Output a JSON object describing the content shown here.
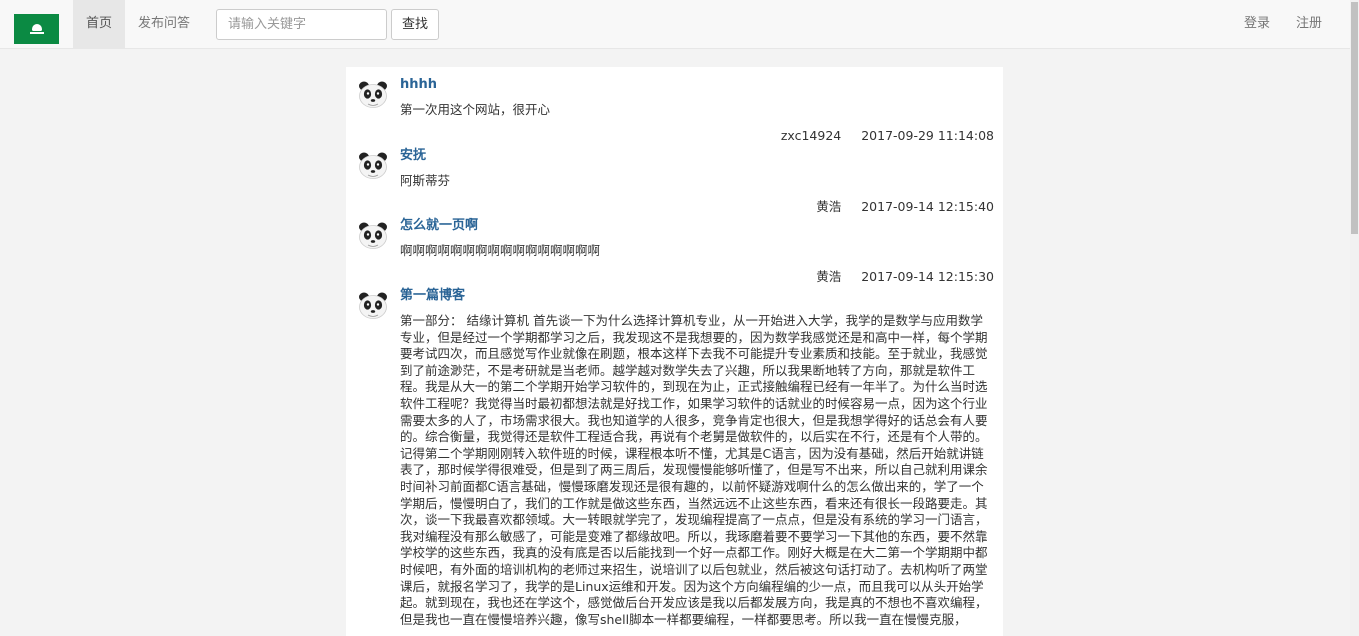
{
  "navbar": {
    "brand_icon": "macau-flag-icon",
    "brand_color": "#0b8a43",
    "home_label": "首页",
    "ask_label": "发布问答",
    "search_placeholder": "请输入关键字",
    "search_button_label": "查找",
    "login_label": "登录",
    "register_label": "注册"
  },
  "posts": [
    {
      "title": "hhhh",
      "body": "第一次用这个网站，很开心",
      "author": "zxc14924",
      "time": "2017-09-29 11:14:08"
    },
    {
      "title": "安抚",
      "body": "阿斯蒂芬",
      "author": "黄浩",
      "time": "2017-09-14 12:15:40"
    },
    {
      "title": "怎么就一页啊",
      "body": "啊啊啊啊啊啊啊啊啊啊啊啊啊啊啊啊",
      "author": "黄浩",
      "time": "2017-09-14 12:15:30"
    },
    {
      "title": "第一篇博客",
      "body": "第一部分： 结缘计算机 首先谈一下为什么选择计算机专业，从一开始进入大学，我学的是数学与应用数学专业，但是经过一个学期都学习之后，我发现这不是我想要的，因为数学我感觉还是和高中一样，每个学期要考试四次，而且感觉写作业就像在刷题，根本这样下去我不可能提升专业素质和技能。至于就业，我感觉到了前途渺茫，不是考研就是当老师。越学越对数学失去了兴趣，所以我果断地转了方向，那就是软件工程。我是从大一的第二个学期开始学习软件的，到现在为止，正式接触编程已经有一年半了。为什么当时选软件工程呢？我觉得当时最初都想法就是好找工作，如果学习软件的话就业的时候容易一点，因为这个行业需要太多的人了，市场需求很大。我也知道学的人很多，竞争肯定也很大，但是我想学得好的话总会有人要的。综合衡量，我觉得还是软件工程适合我，再说有个老舅是做软件的，以后实在不行，还是有个人带的。记得第二个学期刚刚转入软件班的时候，课程根本听不懂，尤其是C语言，因为没有基础，然后开始就讲链表了，那时候学得很难受，但是到了两三周后，发现慢慢能够听懂了，但是写不出来，所以自己就利用课余时间补习前面都C语言基础，慢慢琢磨发现还是很有趣的，以前怀疑游戏啊什么的怎么做出来的，学了一个学期后，慢慢明白了，我们的工作就是做这些东西，当然远远不止这些东西，看来还有很长一段路要走。其次，谈一下我最喜欢都领域。大一转眼就学完了，发现编程提高了一点点，但是没有系统的学习一门语言，我对编程没有那么敏感了，可能是变难了都缘故吧。所以，我琢磨着要不要学习一下其他的东西，要不然靠学校学的这些东西，我真的没有底是否以后能找到一个好一点都工作。刚好大概是在大二第一个学期期中都时候吧，有外面的培训机构的老师过来招生，说培训了以后包就业，然后被这句话打动了。去机构听了两堂课后，就报名学习了，我学的是Linux运维和开发。因为这个方向编程编的少一点，而且我可以从头开始学起。就到现在，我也还在学这个，感觉做后台开发应该是我以后都发展方向，我是真的不想也不喜欢编程，但是我也一直在慢慢培养兴趣，像写shell脚本一样都要编程，一样都要思考。所以我一直在慢慢克服，"
    }
  ]
}
